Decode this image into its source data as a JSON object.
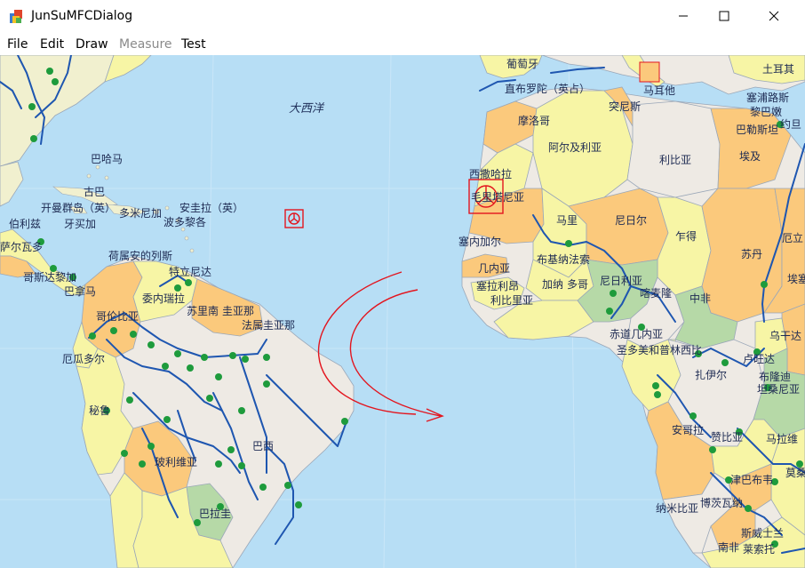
{
  "window": {
    "title": "JunSuMFCDialog"
  },
  "menu": {
    "file": "File",
    "edit": "Edit",
    "draw": "Draw",
    "measure": "Measure",
    "test": "Test"
  },
  "colors": {
    "ocean": "#b7def5",
    "river": "#1e56b0",
    "city": "#1e9b3c",
    "highlight": "#e3151e"
  },
  "map": {
    "ocean": "大西洋",
    "labels": {
      "greenland_label": "葡萄牙",
      "gibraltar": "直布罗陀（英占）",
      "morocco": "摩洛哥",
      "tunisia": "突尼斯",
      "malta": "马耳他",
      "algeria": "阿尔及利亚",
      "libya": "利比亚",
      "egypt": "埃及",
      "turkey": "土耳其",
      "cyprus": "塞浦路斯",
      "lebanon": "黎巴嫩",
      "israel": "巴勒斯坦",
      "jordan": "约旦",
      "w_sahara": "西撒哈拉",
      "mauritania": "毛里塔尼亚",
      "mali": "马里",
      "niger": "尼日尔",
      "chad": "乍得",
      "sudan": "苏丹",
      "eritrea": "厄立",
      "ethiopia": "埃塞",
      "senegal": "塞内加尔",
      "guinea": "几内亚",
      "burkina": "布基纳法索",
      "sierra": "塞拉利昂",
      "liberia": "利比里亚",
      "ghana": "加纳",
      "togo": "多哥",
      "nigeria": "尼日利亚",
      "cameroon": "喀麦隆",
      "car": "中非",
      "eq_guinea": "赤道几内亚",
      "stp": "圣多美和普林西比",
      "drc": "扎伊尔",
      "rwanda": "卢旺达",
      "uganda": "乌干达",
      "burundi": "布隆迪",
      "tanzania": "坦桑尼亚",
      "angola": "安哥拉",
      "zambia": "赞比亚",
      "malawi": "马拉维",
      "mozambique": "莫桑",
      "zimbabwe": "津巴布韦",
      "namibia": "纳米比亚",
      "botswana": "博茨瓦纳",
      "swaziland": "斯威士兰",
      "south_africa": "南非",
      "lesotho": "莱索托",
      "bahamas": "巴哈马",
      "cuba": "古巴",
      "cayman": "开曼群岛（英）",
      "dominican": "多米尼加",
      "anguilla": "安圭拉（英）",
      "guadeloupe": "波多黎各",
      "belize": "伯利兹",
      "jamaica": "牙买加",
      "salvador": "萨尔瓦多",
      "costa_rica": "哥斯达黎加",
      "panama": "巴拿马",
      "netherlands_antilles": "荷属安的列斯",
      "trinidad": "特立尼达",
      "venezuela": "委内瑞拉",
      "suriname": "苏里南",
      "guiana": "圭亚那",
      "french_guiana": "法属圭亚那",
      "colombia": "哥伦比亚",
      "ecuador": "厄瓜多尔",
      "peru": "秘鲁",
      "bolivia": "玻利维亚",
      "brazil": "巴西",
      "paraguay": "巴拉圭"
    }
  }
}
